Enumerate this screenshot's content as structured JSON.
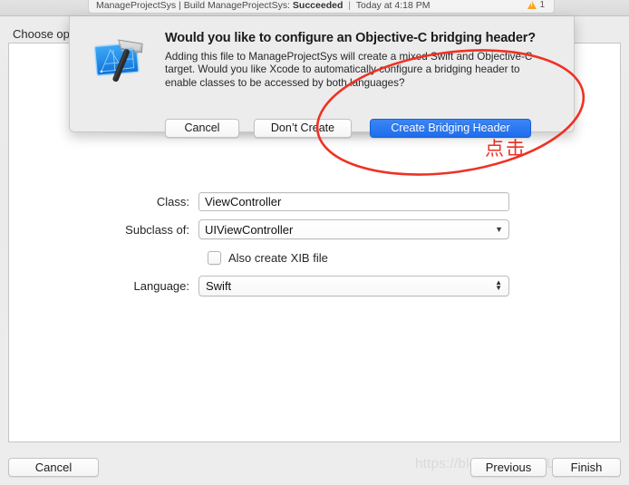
{
  "window": {
    "status_bar": {
      "project_build": "ManageProjectSys | Build ManageProjectSys:",
      "result": "Succeeded",
      "separator": "|",
      "timestamp": "Today at 4:18 PM",
      "warning_count": "1",
      "warning_icon": "warning-triangle-icon"
    },
    "assistant_prompt": "Choose op"
  },
  "form": {
    "class": {
      "label": "Class:",
      "value": "ViewController"
    },
    "subclass": {
      "label": "Subclass of:",
      "value": "UIViewController",
      "chevron_icon": "chevron-down-icon"
    },
    "xib": {
      "label": "Also create XIB file",
      "checked": false
    },
    "language": {
      "label": "Language:",
      "value": "Swift",
      "stepper_icon": "chevron-up-down-icon"
    }
  },
  "footer": {
    "cancel_label": "Cancel",
    "previous_label": "Previous",
    "finish_label": "Finish",
    "watermark": "https://blog.csdn.net/LAO...g 1"
  },
  "sheet": {
    "icon": "xcode-app-icon",
    "title": "Would you like to configure an Objective-C bridging header?",
    "message": "Adding this file to ManageProjectSys will create a mixed Swift and Objective-C target. Would you like Xcode to automatically configure a bridging header to enable classes to be accessed by both languages?",
    "buttons": {
      "cancel": "Cancel",
      "dont_create": "Don’t Create",
      "create_bridging_header": "Create Bridging Header"
    }
  },
  "annotation": {
    "text": "点击",
    "color": "#ef3124",
    "shape": "ellipse-highlight"
  },
  "colors": {
    "accent_blue": "#1e6ded",
    "annotation_red": "#ef3124",
    "warning_orange": "#f5a623",
    "sheet_background": "#ececec",
    "window_background": "#ececec",
    "panel_background": "#ffffff"
  }
}
